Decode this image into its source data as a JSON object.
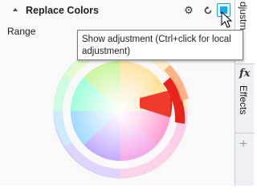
{
  "panel": {
    "title": "Replace Colors",
    "range_label": "Range"
  },
  "header_icons": {
    "collapse": "collapse-arrow-icon",
    "settings": "gear-icon",
    "reset": "reset-icon",
    "show_adjustment": "show-adjustment-toggle-icon"
  },
  "tooltip": {
    "line1": "Show adjustment (Ctrl+click for local",
    "line2": "adjustment)"
  },
  "side_panel": {
    "adjustments_tab_label": "djustm",
    "effects_icon": "fx",
    "effects_tab_label": "Effects",
    "add_label": "+"
  },
  "colors": {
    "accent": "#19a8e8",
    "selection_red": "#e8231a"
  }
}
